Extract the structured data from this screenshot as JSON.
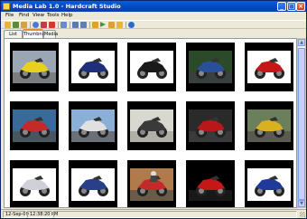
{
  "window": {
    "title": "Media Lab 1.0 - Hardcraft Studio",
    "minimize": "_",
    "maximize": "□",
    "close": "×"
  },
  "menu": [
    {
      "label": "File"
    },
    {
      "label": "Find"
    },
    {
      "label": "View"
    },
    {
      "label": "Tools"
    },
    {
      "label": "Help"
    }
  ],
  "toolbar": [
    {
      "icon": "open-folder-icon",
      "color": "#e7b53c"
    },
    {
      "icon": "save-icon",
      "color": "#5b8a3a"
    },
    {
      "icon": "user-icon",
      "color": "#d4a04a"
    },
    {
      "icon": "sep"
    },
    {
      "icon": "globe-icon",
      "color": "#4a7bd4"
    },
    {
      "icon": "heart-icon",
      "color": "#c83a4a"
    },
    {
      "icon": "delete-icon",
      "color": "#d23a2a"
    },
    {
      "icon": "sep"
    },
    {
      "icon": "list-icon",
      "color": "#6a8ad0"
    },
    {
      "icon": "sep"
    },
    {
      "icon": "calendar-icon",
      "color": "#5a7ab4"
    },
    {
      "icon": "grid-icon",
      "color": "#5d7fb5"
    },
    {
      "icon": "sep"
    },
    {
      "icon": "back-icon",
      "color": "#e0a030"
    },
    {
      "icon": "play-icon",
      "color": "#3a9a3a"
    },
    {
      "icon": "forward-icon",
      "color": "#e0a030"
    },
    {
      "icon": "folder-icon",
      "color": "#e7b53c"
    },
    {
      "icon": "sep"
    },
    {
      "icon": "info-icon",
      "color": "#2a6acf"
    }
  ],
  "tabs": [
    {
      "label": "List View",
      "active": false
    },
    {
      "label": "Thumbnail",
      "active": true
    },
    {
      "label": "Media",
      "active": false
    }
  ],
  "thumbnails": [
    {
      "subject": "yellow-bike",
      "bg": "#9aa6b4",
      "ground": "#7a7e80",
      "color": "#e8d020"
    },
    {
      "subject": "blue-bike",
      "bg": "#ffffff",
      "ground": "#ffffff",
      "color": "#1f2f7a"
    },
    {
      "subject": "black-bike",
      "bg": "#ffffff",
      "ground": "#ffffff",
      "color": "#1a1a1a"
    },
    {
      "subject": "green-bike",
      "bg": "#2a4a2a",
      "ground": "#3a3f40",
      "color": "#2a4f9a"
    },
    {
      "subject": "red-bike",
      "bg": "#ffffff",
      "ground": "#ffffff",
      "color": "#c41818"
    },
    {
      "subject": "red-bike",
      "bg": "#3a6a9a",
      "ground": "#4a5560",
      "color": "#c42a2a"
    },
    {
      "subject": "track-bike",
      "bg": "#8ab0d8",
      "ground": "#6a6f78",
      "color": "#e0e0e0"
    },
    {
      "subject": "grey-bike",
      "bg": "#d8d8d0",
      "ground": "#b0b0a8",
      "color": "#3a3a3a"
    },
    {
      "subject": "red-bike",
      "bg": "#2a2a2a",
      "ground": "#3a3a3a",
      "color": "#b81818"
    },
    {
      "subject": "yellow-bike",
      "bg": "#6a7f5a",
      "ground": "#5a5a50",
      "color": "#d8b020"
    },
    {
      "subject": "white-bike",
      "bg": "#ffffff",
      "ground": "#ffffff",
      "color": "#d0d0d8"
    },
    {
      "subject": "blue-bike",
      "bg": "#ffffff",
      "ground": "#ffffff",
      "color": "#2a3f8a"
    },
    {
      "subject": "rider-bike",
      "bg": "#b07a4a",
      "ground": "#6a5a48",
      "color": "#c42a2a"
    },
    {
      "subject": "red-bike",
      "bg": "#000000",
      "ground": "#181818",
      "color": "#c41818"
    },
    {
      "subject": "blue-bike",
      "bg": "#ffffff",
      "ground": "#ffffff",
      "color": "#1f3a9a"
    }
  ],
  "statusbar": {
    "date": "12-Sep-09",
    "time": "12:38:20 PM",
    "message": ""
  },
  "colors": {
    "titlebar": "#0348c4",
    "active_tab_accent": "#e68b2c",
    "thumb_frame": "#000000"
  }
}
